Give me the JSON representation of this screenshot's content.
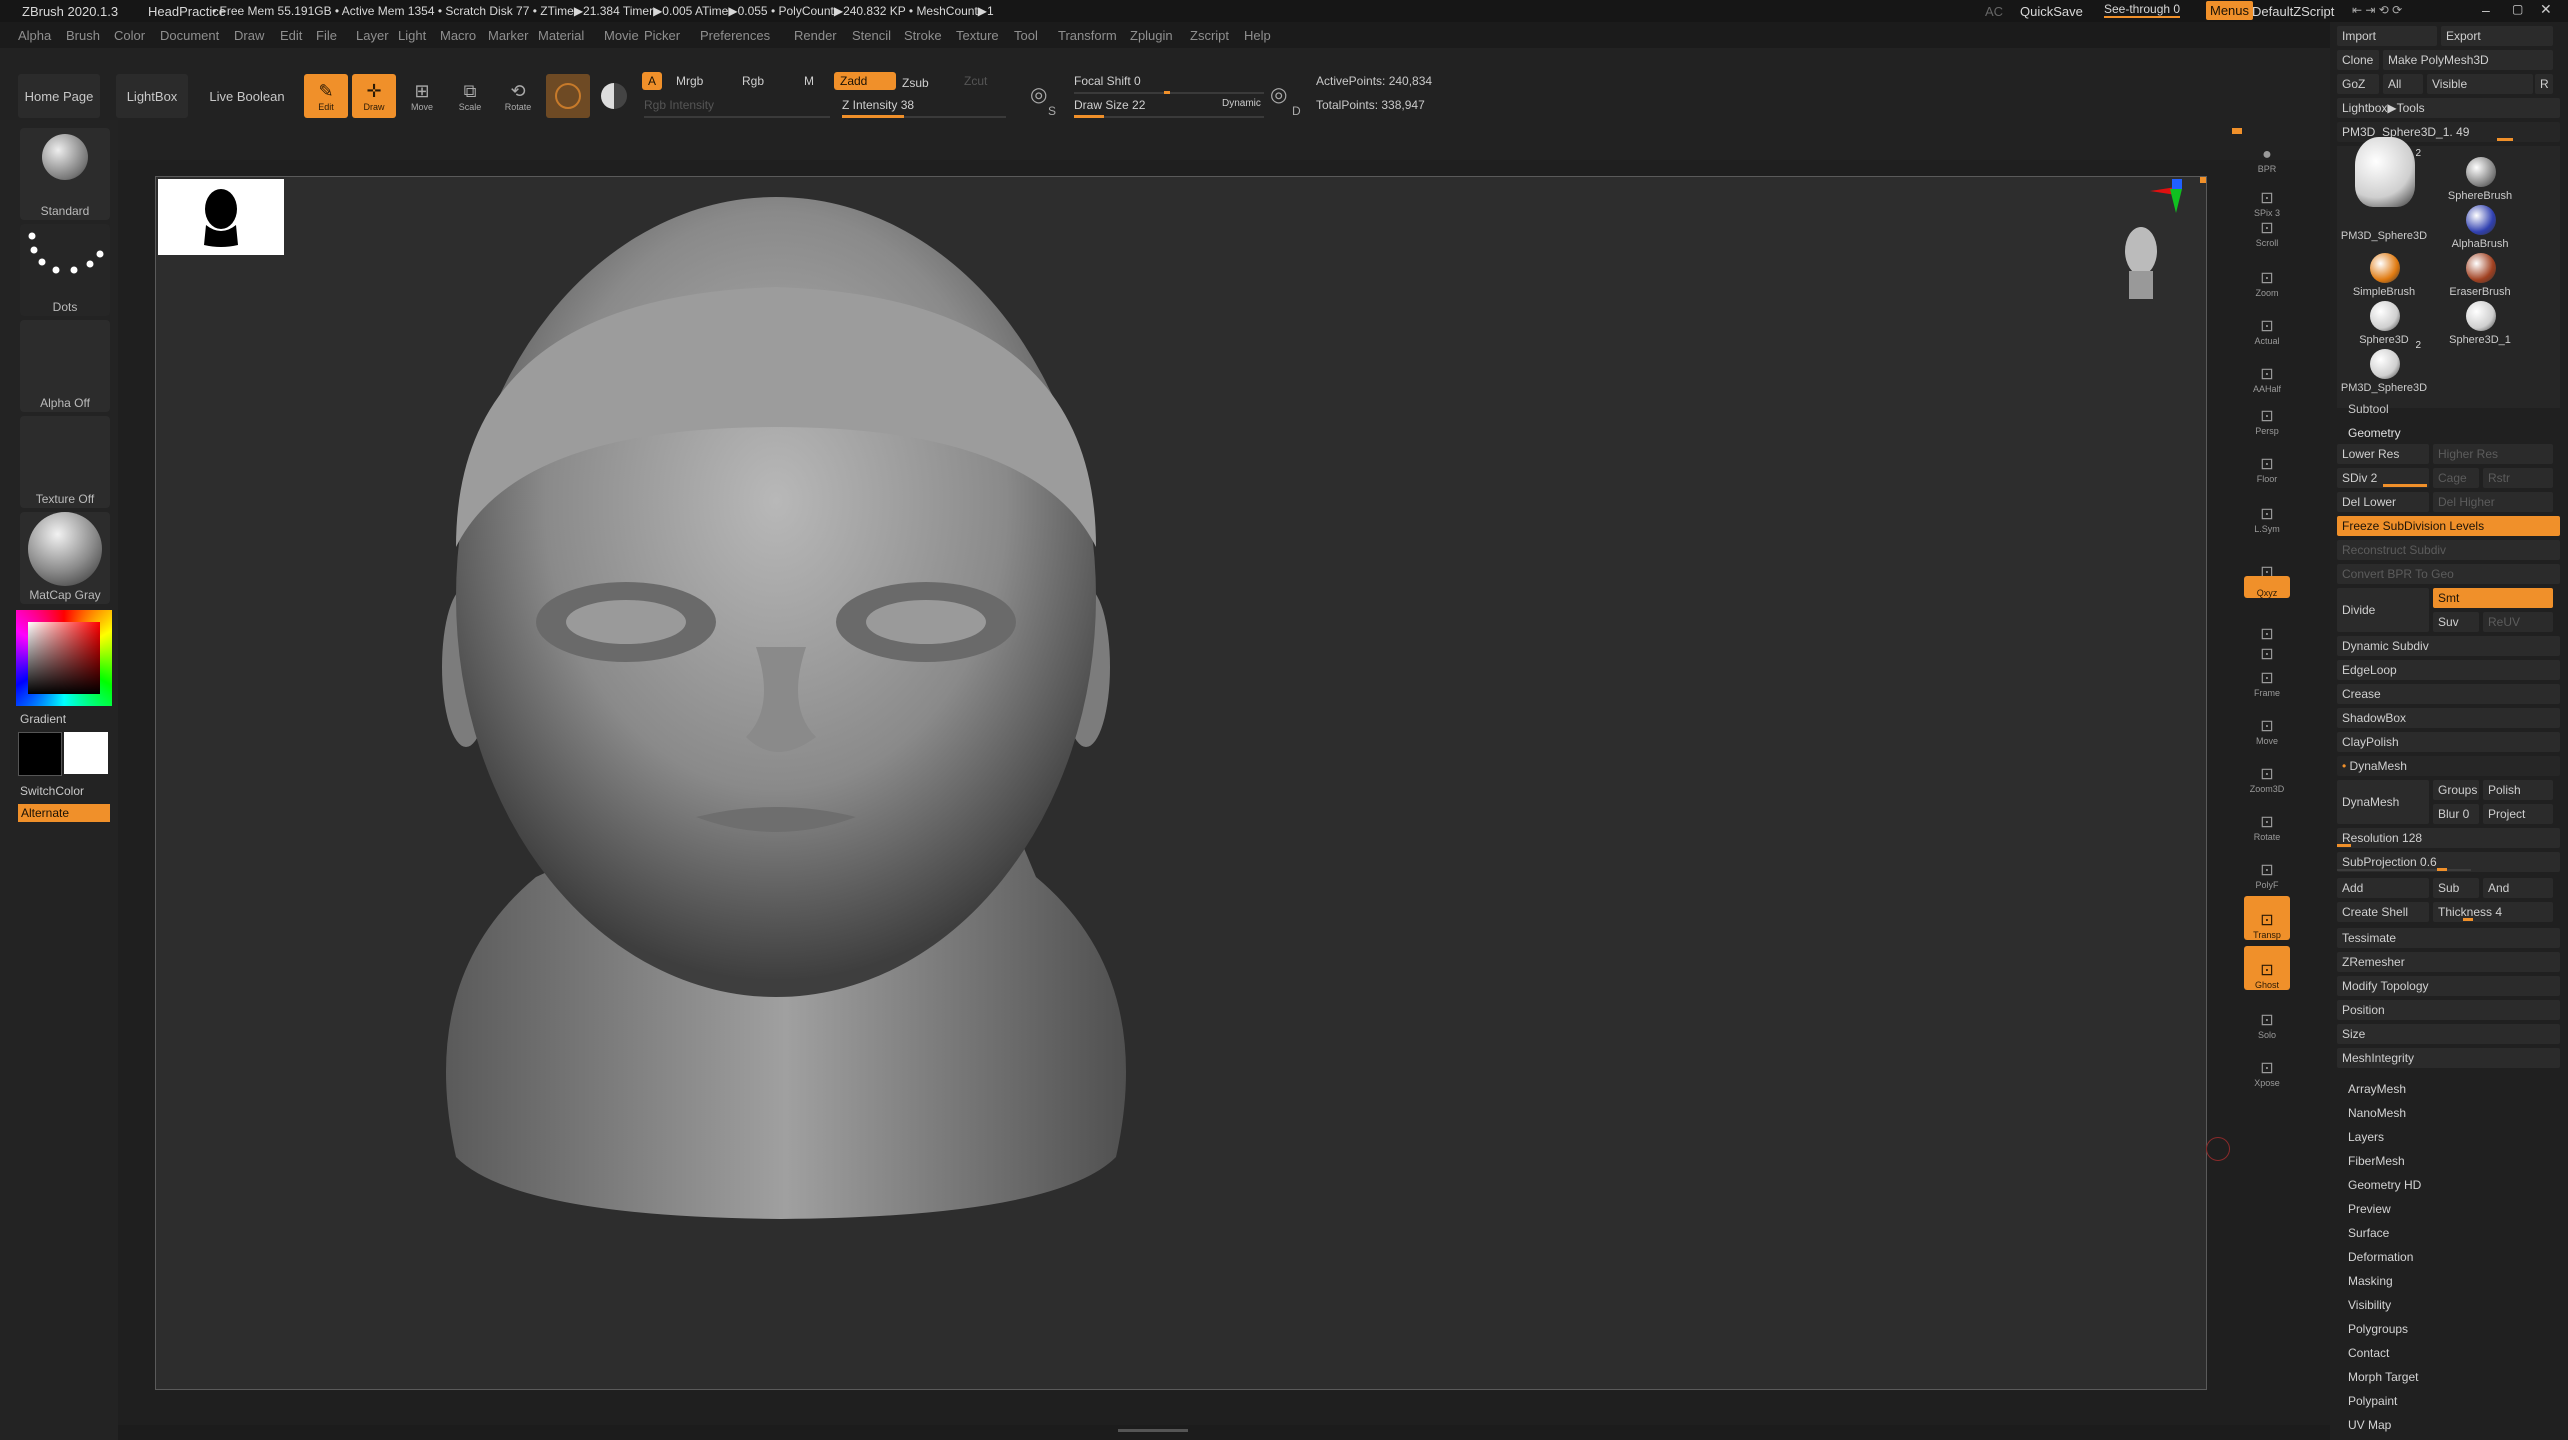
{
  "title_bar": {
    "app": "ZBrush 2020.1.3",
    "document": "HeadPractice",
    "stats": "• Free Mem 55.191GB • Active Mem 1354 • Scratch Disk 77 • ZTime▶21.384 Timer▶0.005 ATime▶0.055 • PolyCount▶240.832 KP • MeshCount▶1",
    "ac": "AC",
    "quicksave": "QuickSave",
    "see_through": "See-through  0",
    "menus": "Menus",
    "zscript": "DefaultZScript"
  },
  "menu": [
    "Alpha",
    "Brush",
    "Color",
    "Document",
    "Draw",
    "Edit",
    "File",
    "Layer",
    "Light",
    "Macro",
    "Marker",
    "Material",
    "Movie",
    "Picker",
    "Preferences",
    "Render",
    "Stencil",
    "Stroke",
    "Texture",
    "Tool",
    "Transform",
    "Zplugin",
    "Zscript",
    "Help"
  ],
  "shelf": {
    "home_page": "Home Page",
    "lightbox": "LightBox",
    "live_boolean": "Live Boolean",
    "edit": "Edit",
    "draw": "Draw",
    "move": "Move",
    "scale": "Scale",
    "rotate": "Rotate",
    "a": "A",
    "mrgb": "Mrgb",
    "rgb": "Rgb",
    "m": "M",
    "zadd": "Zadd",
    "zsub": "Zsub",
    "zcut": "Zcut",
    "rgb_intensity": "Rgb Intensity",
    "z_intensity_label": "Z Intensity 38",
    "z_intensity": 38,
    "focal_shift_label": "Focal Shift 0",
    "draw_size_label": "Draw Size 22",
    "dynamic": "Dynamic",
    "active_points": "ActivePoints: 240,834",
    "total_points": "TotalPoints: 338,947",
    "s": "S",
    "d": "D"
  },
  "left_tray": {
    "standard": "Standard",
    "dots": "Dots",
    "alpha_off": "Alpha Off",
    "texture_off": "Texture Off",
    "matcap": "MatCap Gray",
    "gradient": "Gradient",
    "switchcolor": "SwitchColor",
    "alternate": "Alternate"
  },
  "right_toolbar": [
    "BPR",
    "SPix 3",
    "Scroll",
    "Zoom",
    "Actual",
    "AAHalf",
    "Persp",
    "Floor",
    "L.Sym",
    "",
    "Qxyz",
    "",
    "",
    "Frame",
    "Move",
    "Zoom3D",
    "Rotate",
    "PolyF",
    "Transp",
    "Ghost",
    "Solo",
    "Xpose"
  ],
  "right_panel": {
    "import": "Import",
    "export": "Export",
    "clone": "Clone",
    "make_polymesh": "Make PolyMesh3D",
    "goz": "GoZ",
    "all": "All",
    "visible": "Visible",
    "r": "R",
    "lightbox_tools": "Lightbox▶Tools",
    "current_tool": "PM3D_Sphere3D_1. 49",
    "tools": [
      {
        "name": "PM3D_Sphere3D",
        "badge": "2"
      },
      {
        "name": "SphereBrush",
        "badge": ""
      },
      {
        "name": "AlphaBrush",
        "badge": ""
      },
      {
        "name": "SimpleBrush",
        "badge": ""
      },
      {
        "name": "EraserBrush",
        "badge": ""
      },
      {
        "name": "Sphere3D",
        "badge": ""
      },
      {
        "name": "Sphere3D_1",
        "badge": ""
      },
      {
        "name": "PM3D_Sphere3D",
        "badge": "2"
      }
    ],
    "subtool": "Subtool",
    "geometry": "Geometry",
    "lower_res": "Lower Res",
    "higher_res": "Higher Res",
    "sdiv": "SDiv 2",
    "cage": "Cage",
    "rstr": "Rstr",
    "del_lower": "Del Lower",
    "del_higher": "Del Higher",
    "freeze": "Freeze SubDivision Levels",
    "reconstruct": "Reconstruct Subdiv",
    "convert_bpr": "Convert BPR To Geo",
    "divide": "Divide",
    "smt": "Smt",
    "suv": "Suv",
    "reuv": "ReUV",
    "dynamic_subdiv": "Dynamic Subdiv",
    "edgeloop": "EdgeLoop",
    "crease": "Crease",
    "shadowbox": "ShadowBox",
    "claypolish": "ClayPolish",
    "dynamesh_header": "DynaMesh",
    "dynamesh_btn": "DynaMesh",
    "groups": "Groups",
    "polish": "Polish",
    "blur": "Blur 0",
    "project": "Project",
    "resolution_label": "Resolution 128",
    "subprojection_label": "SubProjection 0.6",
    "add": "Add",
    "sub": "Sub",
    "and": "And",
    "create_shell": "Create Shell",
    "thickness_label": "Thickness 4",
    "tessimate": "Tessimate",
    "zremesher": "ZRemesher",
    "modify_topology": "Modify Topology",
    "position": "Position",
    "size": "Size",
    "meshintegrity": "MeshIntegrity",
    "subtool_menus": [
      "ArrayMesh",
      "NanoMesh",
      "Layers",
      "FiberMesh",
      "Geometry HD",
      "Preview",
      "Surface",
      "Deformation",
      "Masking",
      "Visibility",
      "Polygroups",
      "Contact",
      "Morph Target",
      "Polypaint",
      "UV Map"
    ]
  },
  "colors": {
    "accent": "#f0902a",
    "background": "#1f1f1f",
    "viewport": "#2d2d2d",
    "main_color": "#000000",
    "secondary_color": "#ffffff"
  }
}
